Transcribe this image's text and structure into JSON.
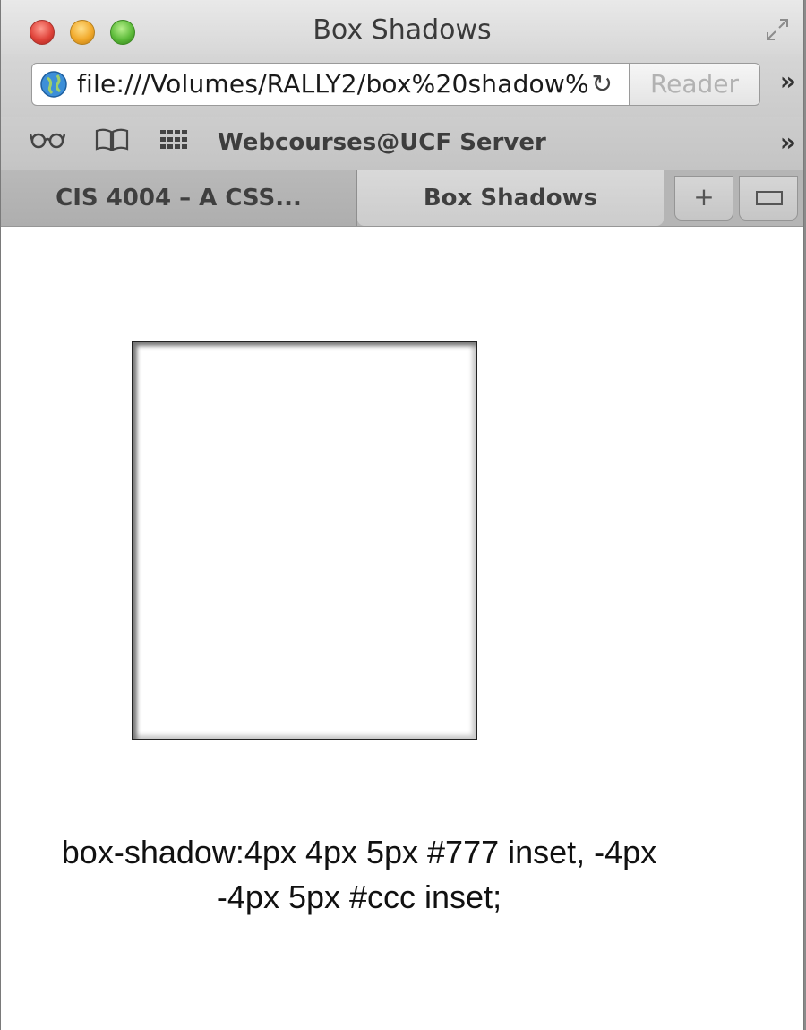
{
  "window": {
    "title": "Box Shadows"
  },
  "address_bar": {
    "url": "file:///Volumes/RALLY2/box%20shadow%",
    "reader_label": "Reader"
  },
  "bookmarks": {
    "icons": [
      "reading-list-icon",
      "bookmarks-icon",
      "top-sites-icon"
    ],
    "link_label": "Webcourses@UCF Server"
  },
  "tabs": [
    {
      "label": "CIS 4004 – A CSS...",
      "active": false
    },
    {
      "label": "Box Shadows",
      "active": true
    }
  ],
  "content": {
    "caption": "box-shadow:4px 4px 5px #777 inset, -4px -4px 5px #ccc inset;"
  },
  "colors": {
    "shadow_dark": "#777777",
    "shadow_light": "#cccccc",
    "border": "#222222"
  }
}
